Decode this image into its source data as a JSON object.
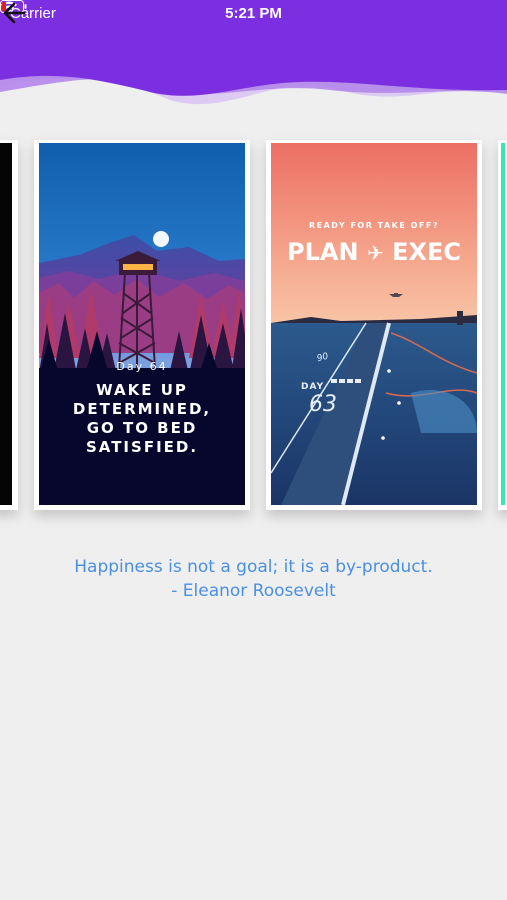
{
  "status_bar": {
    "carrier": "Carrier",
    "time": "5:21 PM"
  },
  "header": {
    "back_icon": "arrow-left-icon",
    "colors": {
      "primary": "#7b2fe0",
      "wave_light": "#c9a6ee"
    }
  },
  "cards": [
    {
      "day_label": "Day 64",
      "line1": "WAKE UP",
      "line2": "DETERMINED,",
      "line3": "GO TO BED",
      "line4": "SATISFIED."
    },
    {
      "tagline": "READY FOR TAKE OFF?",
      "title_left": "PLAN",
      "title_right": "EXEC",
      "day_label": "DAY",
      "day_number": "63",
      "runway_number": "90"
    }
  ],
  "quote": {
    "text": "Happiness is not a goal; it is a by-product.",
    "author": "- Eleanor Roosevelt"
  }
}
